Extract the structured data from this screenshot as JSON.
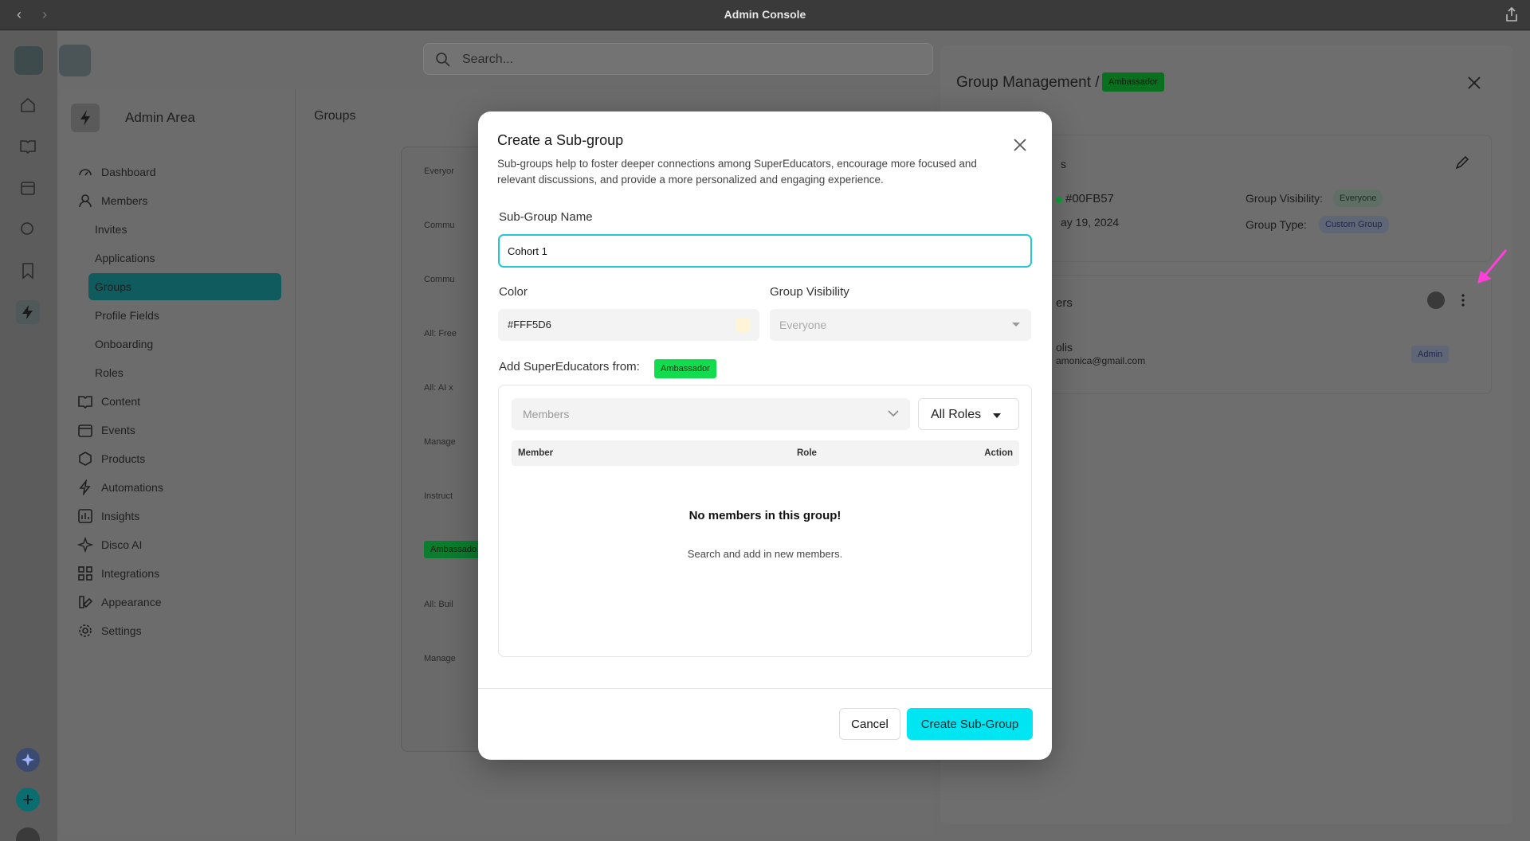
{
  "window": {
    "title": "Admin Console"
  },
  "search": {
    "placeholder": "Search..."
  },
  "sidebar": {
    "header": "Admin Area",
    "items": [
      {
        "label": "Dashboard",
        "icon": "dashboard-icon"
      },
      {
        "label": "Members",
        "icon": "user-icon"
      },
      {
        "label": "Invites"
      },
      {
        "label": "Applications"
      },
      {
        "label": "Groups",
        "active": true
      },
      {
        "label": "Profile Fields"
      },
      {
        "label": "Onboarding"
      },
      {
        "label": "Roles"
      },
      {
        "label": "Content",
        "icon": "book-icon"
      },
      {
        "label": "Events",
        "icon": "calendar-icon"
      },
      {
        "label": "Products",
        "icon": "box-icon"
      },
      {
        "label": "Automations",
        "icon": "bolt-icon"
      },
      {
        "label": "Insights",
        "icon": "chart-icon"
      },
      {
        "label": "Disco AI",
        "icon": "sparkle-icon"
      },
      {
        "label": "Integrations",
        "icon": "grid-icon"
      },
      {
        "label": "Appearance",
        "icon": "palette-icon"
      },
      {
        "label": "Settings",
        "icon": "gear-icon"
      }
    ]
  },
  "groups_page": {
    "title": "Groups",
    "rows": [
      "Everyor",
      "Commu",
      "Commu",
      "All: Free",
      "All: AI x",
      "Manage",
      "Instruct",
      "Ambassado",
      "All: Buil",
      "Manage"
    ]
  },
  "drawer": {
    "title": "Group Management /",
    "badge": "Ambassador",
    "color_value": "#00FB57",
    "date_fragment": "ay 19, 2024",
    "visibility_label": "Group Visibility:",
    "visibility_value": "Everyone",
    "type_label": "Group Type:",
    "type_value": "Custom Group",
    "members_fragment": "ers",
    "section_fragment": "s",
    "member_name_fragment": "olis",
    "member_email_fragment": "amonica@gmail.com",
    "member_role": "Admin"
  },
  "modal": {
    "title": "Create a Sub-group",
    "description": "Sub-groups help to foster deeper connections among SuperEducators, encourage more focused and relevant discussions, and provide a more personalized and engaging experience.",
    "name_label": "Sub-Group Name",
    "name_value": "Cohort 1",
    "color_label": "Color",
    "color_value": "#FFF5D6",
    "color_swatch": "#FFF5D6",
    "visibility_label": "Group Visibility",
    "visibility_value": "Everyone",
    "add_from_label": "Add SuperEducators from:",
    "add_from_badge": "Ambassador",
    "members_placeholder": "Members",
    "roles_filter": "All Roles",
    "columns": [
      "Member",
      "Role",
      "Action"
    ],
    "empty_title": "No members in this group!",
    "empty_subtitle": "Search and add in new members.",
    "cancel_label": "Cancel",
    "create_label": "Create Sub-Group"
  },
  "colors": {
    "accent": "#00E5F2",
    "focus": "#25C6D4",
    "badge_green": "#12DC4E",
    "active_nav": "#0F5B5E",
    "arrow": "#FF3FD8"
  }
}
